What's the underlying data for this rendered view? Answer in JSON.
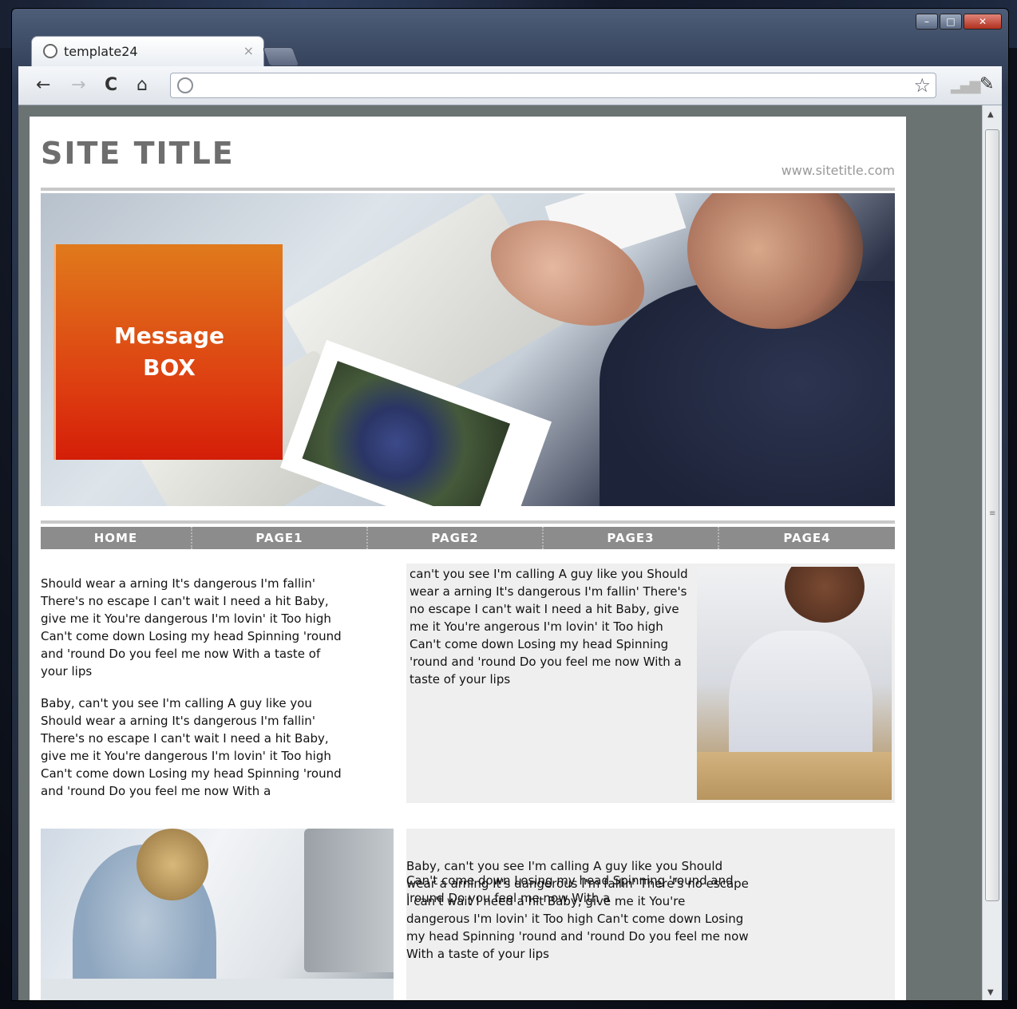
{
  "browser": {
    "tab_title": "template24",
    "tab_close": "×",
    "address_value": "",
    "window_controls": {
      "minimize": "–",
      "maximize": "□",
      "close": "✕"
    },
    "toolbar": {
      "back": "←",
      "forward": "→",
      "reload": "C",
      "home": "⌂",
      "star": "☆",
      "wrench": "🔧"
    }
  },
  "page": {
    "site_title": "SITE TITLE",
    "site_url": "www.sitetitle.com",
    "message_box": "Message\nBOX",
    "nav": [
      "HOME",
      "PAGE1",
      "PAGE2",
      "PAGE3",
      "PAGE4"
    ],
    "col1_p1": "Should wear a arning It's dangerous I'm fallin' There's no escape I can't wait I need a hit Baby, give me it You're dangerous I'm lovin' it Too high Can't come down Losing my head Spinning 'round and 'round Do you feel me now With a taste of your lips",
    "col1_p2": "Baby, can't you see I'm calling A guy like you Should wear a arning It's dangerous I'm fallin' There's no escape I can't wait I need a hit Baby, give me it You're dangerous I'm lovin' it Too high Can't come down Losing my head Spinning 'round and 'round Do you feel me now With a",
    "box_a_text": "can't you see I'm calling A guy like you Should wear a arning It's dangerous I'm fallin' There's no escape I can't wait I need a hit Baby, give me it You're angerous I'm lovin' it Too high Can't come down Losing my head Spinning 'round and 'round Do you feel me now With a taste of your lips",
    "box_b_p1": "Baby, can't you see I'm calling A guy like you Should wear a arning It's dangerous I'm fallin' There's no escape I can't wait I need a hit Baby, give me it You're dangerous I'm lovin' it Too high Can't come down Losing my head Spinning 'round and 'round Do you feel me now With a taste of your lips",
    "box_b_p2": "Can't come down Losing my head Spinning 'round and 'round Do you feel me now With a"
  },
  "colors": {
    "nav_bg": "#8c8c8c",
    "message_box_top": "#e07a1c",
    "message_box_bottom": "#d41e08",
    "content_box_bg": "#efefef",
    "viewport_bg": "#6b7272"
  }
}
